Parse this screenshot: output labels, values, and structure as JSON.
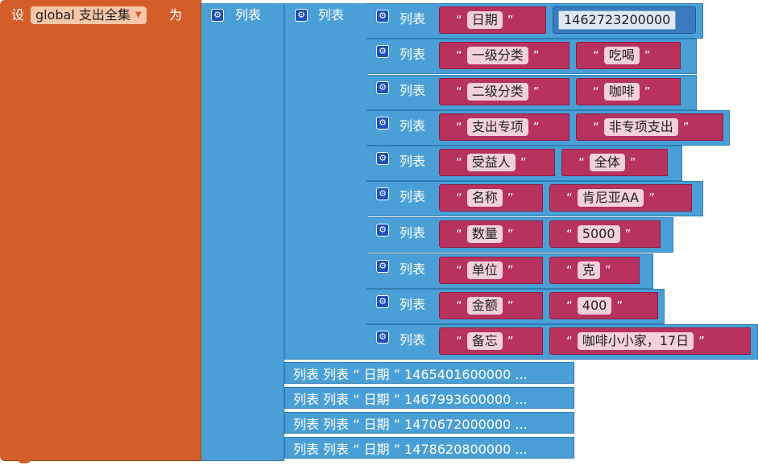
{
  "set_block": {
    "set_label": "设",
    "variable": "global 支出全集",
    "to_label": "为",
    "dropdown_icon": "caret-down-icon"
  },
  "list_label": "列表",
  "gear_icon": "gear-icon",
  "colors": {
    "set_block": "#d35e2a",
    "list_block": "#4aa0d6",
    "text_block": "#b8325e",
    "number_block": "#3a7bbf"
  },
  "quote_open": "“",
  "quote_close": "”",
  "rows": [
    {
      "key": "日期",
      "value": "1462723200000",
      "value_type": "number"
    },
    {
      "key": "一级分类",
      "value": "吃喝",
      "value_type": "text"
    },
    {
      "key": "二级分类",
      "value": "咖啡",
      "value_type": "text"
    },
    {
      "key": "支出专项",
      "value": "非专项支出",
      "value_type": "text"
    },
    {
      "key": "受益人",
      "value": "全体",
      "value_type": "text"
    },
    {
      "key": "名称",
      "value": "肯尼亚AA",
      "value_type": "text"
    },
    {
      "key": "数量",
      "value": "5000",
      "value_type": "text"
    },
    {
      "key": "单位",
      "value": "克",
      "value_type": "text"
    },
    {
      "key": "金额",
      "value": "400",
      "value_type": "text"
    },
    {
      "key": "备忘",
      "value": "咖啡小小家，17日",
      "value_type": "text"
    }
  ],
  "collapsed_rows": [
    {
      "text": "列表 列表 “ 日期 ” 1465401600000 ..."
    },
    {
      "text": "列表 列表 “ 日期 ” 1467993600000 ..."
    },
    {
      "text": "列表 列表 “ 日期 ” 1470672000000 ..."
    },
    {
      "text": "列表 列表 “ 日期 ” 1478620800000 ..."
    }
  ]
}
